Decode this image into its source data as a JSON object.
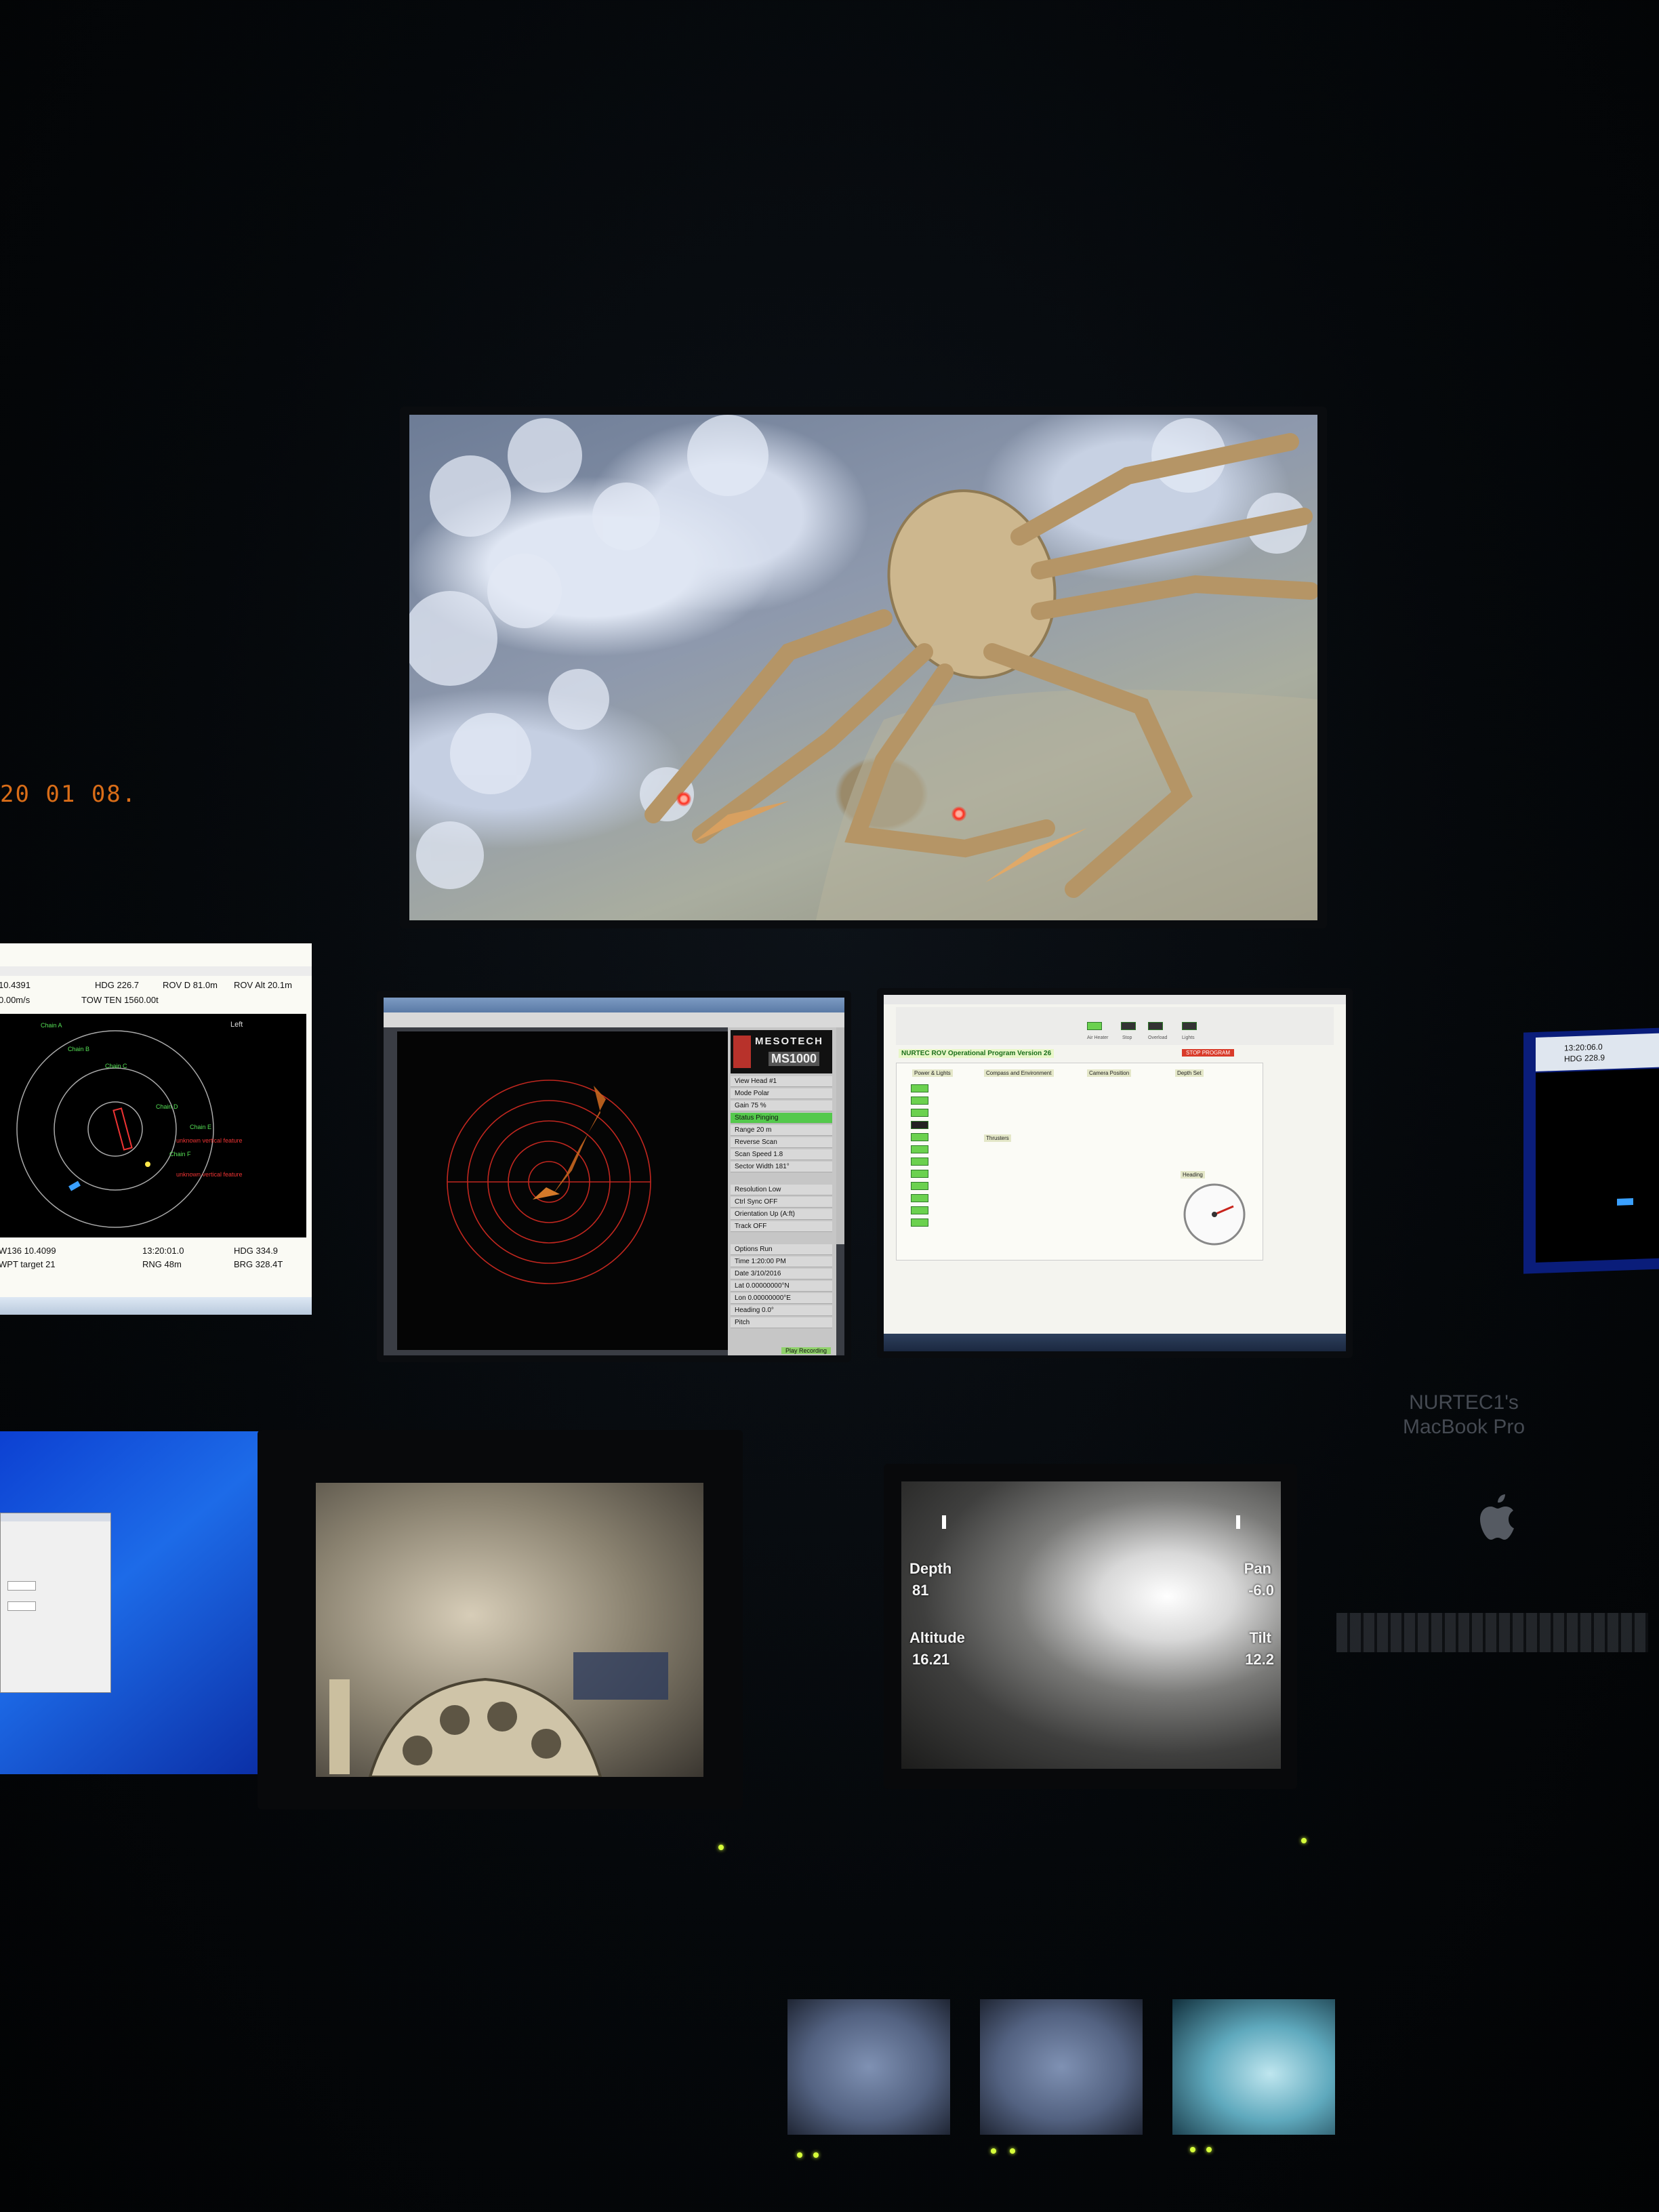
{
  "clock": {
    "digits": "20 01 08."
  },
  "nav_screen": {
    "row1": [
      "10.4391",
      "HDG 226.7",
      "ROV D 81.0m",
      "ROV Alt 20.1m"
    ],
    "row2": [
      "0.00m/s",
      "TOW TEN 1560.00t"
    ],
    "bottom_row1": [
      "W136 10.4099",
      "13:20:01.0",
      "HDG 334.9"
    ],
    "bottom_row2": [
      "WPT target 21",
      "RNG 48m",
      "BRG 328.4T"
    ],
    "plot_label": "Left"
  },
  "sonar": {
    "brand_name": "MESOTECH",
    "brand_model": "MS1000",
    "rows": [
      "View Head #1",
      "Mode Polar",
      "Gain 75 %",
      "Status Pinging",
      "Range 20 m",
      "Reverse Scan",
      "Scan Speed 1.8",
      "Sector Width 181°",
      "Resolution Low",
      "Ctrl Sync OFF",
      "Orientation Up (A:ft)",
      "Track OFF",
      "Options Run",
      "Time 1:20:00 PM",
      "Date 3/10/2016",
      "Lat 0.00000000°N",
      "Lon 0.00000000°E",
      "Heading 0.0°",
      "Pitch"
    ],
    "status_bar": "Play Recording"
  },
  "rov_program": {
    "title": "NURTEC ROV Operational Program Version 26",
    "stop_button": "STOP PROGRAM",
    "indicators": [
      "Air Heater",
      "Stop",
      "Overload",
      "Lights"
    ],
    "section_labels": [
      "Power & Lights",
      "Compass and Environment",
      "Camera Position",
      "Thrusters",
      "Depth Set",
      "Heading"
    ]
  },
  "right_screen": {
    "line1": "13:20:06.0",
    "line2": "HDG 228.9"
  },
  "macbook": {
    "label": "NURTEC1's\nMacBook Pro"
  },
  "cam_right_osd": {
    "depth_label": "Depth",
    "depth_value": "81",
    "altitude_label": "Altitude",
    "altitude_value": "16.21",
    "pan_label": "Pan",
    "pan_value": "-6.0",
    "tilt_label": "Tilt",
    "tilt_value": "12.2"
  }
}
